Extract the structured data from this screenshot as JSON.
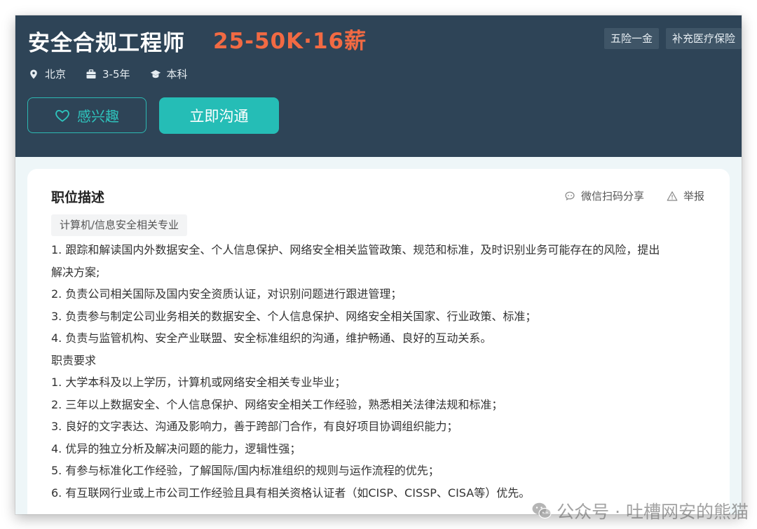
{
  "header": {
    "title": "安全合规工程师",
    "salary": "25-50K·16薪",
    "benefits": [
      "五险一金",
      "补充医疗保险"
    ],
    "meta": {
      "location": "北京",
      "experience": "3-5年",
      "education": "本科"
    },
    "interest_label": "感兴趣",
    "chat_label": "立即沟通"
  },
  "card": {
    "section_title": "职位描述",
    "share_label": "微信扫码分享",
    "report_label": "举报",
    "major_tag": "计算机/信息安全相关专业",
    "lines": [
      "1. 跟踪和解读国内外数据安全、个人信息保护、网络安全相关监管政策、规范和标准，及时识别业务可能存在的风险，提出",
      "解决方案;",
      "2. 负责公司相关国际及国内安全资质认证，对识别问题进行跟进管理；",
      "3. 负责参与制定公司业务相关的数据安全、个人信息保护、网络安全相关国家、行业政策、标准；",
      "4. 负责与监管机构、安全产业联盟、安全标准组织的沟通，维护畅通、良好的互动关系。",
      "职责要求",
      "1. 大学本科及以上学历，计算机或网络安全相关专业毕业；",
      "2. 三年以上数据安全、个人信息保护、网络安全相关工作经验，熟悉相关法律法规和标准；",
      "3. 良好的文字表达、沟通及影响力，善于跨部门合作，有良好项目协调组织能力；",
      "4. 优异的独立分析及解决问题的能力，逻辑性强；",
      "5. 有参与标准化工作经验，了解国际/国内标准组织的规则与运作流程的优先；",
      "6. 有互联网行业或上市公司工作经验且具有相关资格认证者（如CISP、CISSP、CISA等）优先。"
    ]
  },
  "watermark": "公众号 · 吐槽网安的熊猫",
  "colors": {
    "header_bg": "#2e4457",
    "salary": "#f26a43",
    "accent": "#25bdb6",
    "page_bg": "#eef6f8"
  },
  "icons": [
    "location-pin-icon",
    "briefcase-icon",
    "graduation-cap-icon",
    "heart-icon",
    "chat-bubble-icon",
    "warning-icon",
    "wechat-icon"
  ]
}
